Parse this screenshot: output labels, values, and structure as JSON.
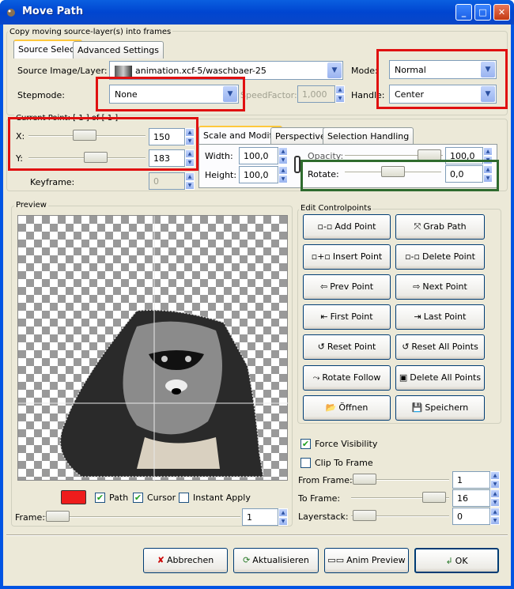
{
  "window": {
    "title": "Move Path"
  },
  "source_group": {
    "label": "Copy moving source-layer(s) into frames"
  },
  "tabs_main": [
    "Source Select",
    "Advanced Settings"
  ],
  "source": {
    "label": "Source Image/Layer:",
    "value": "animation.xcf-5/waschbaer-25",
    "mode_label": "Mode:",
    "mode_value": "Normal",
    "stepmode_label": "Stepmode:",
    "stepmode_value": "None",
    "speedfactor_label": "SpeedFactor:",
    "speedfactor_value": "1,000",
    "handle_label": "Handle:",
    "handle_value": "Center"
  },
  "current_point": {
    "label": "Current Point: [ 1 ] of [ 1 ]",
    "x_label": "X:",
    "x_value": "150",
    "y_label": "Y:",
    "y_value": "183",
    "keyframe_label": "Keyframe:",
    "keyframe_value": "0"
  },
  "tabs_sub": [
    "Scale and Modify",
    "Perspective",
    "Selection Handling"
  ],
  "modify": {
    "width_label": "Width:",
    "width_value": "100,0",
    "height_label": "Height:",
    "height_value": "100,0",
    "opacity_label": "Opacity:",
    "opacity_value": "100,0",
    "rotate_label": "Rotate:",
    "rotate_value": "0,0"
  },
  "preview": {
    "label": "Preview"
  },
  "controlpoints": {
    "label": "Edit Controlpoints",
    "buttons": [
      "Add Point",
      "Grab Path",
      "Insert Point",
      "Delete Point",
      "Prev Point",
      "Next Point",
      "First Point",
      "Last Point",
      "Reset Point",
      "Reset All Points",
      "Rotate Follow",
      "Delete All Points",
      "Öffnen",
      "Speichern"
    ]
  },
  "preview_opts": {
    "path_label": "Path",
    "cursor_label": "Cursor",
    "instant_label": "Instant Apply",
    "frame_label": "Frame:",
    "frame_value": "1",
    "color": "#ee1c1c"
  },
  "options": {
    "force_visibility": "Force Visibility",
    "clip_to_frame": "Clip To Frame",
    "from_label": "From Frame:",
    "from_value": "1",
    "to_label": "To Frame:",
    "to_value": "16",
    "layerstack_label": "Layerstack:",
    "layerstack_value": "0"
  },
  "footer": {
    "cancel": "Abbrechen",
    "refresh": "Aktualisieren",
    "anim": "Anim Preview",
    "ok": "OK"
  },
  "colors": {
    "highlight_red": "#e01010",
    "highlight_green": "#2e6b2e",
    "titlebar": "#0054e3"
  }
}
